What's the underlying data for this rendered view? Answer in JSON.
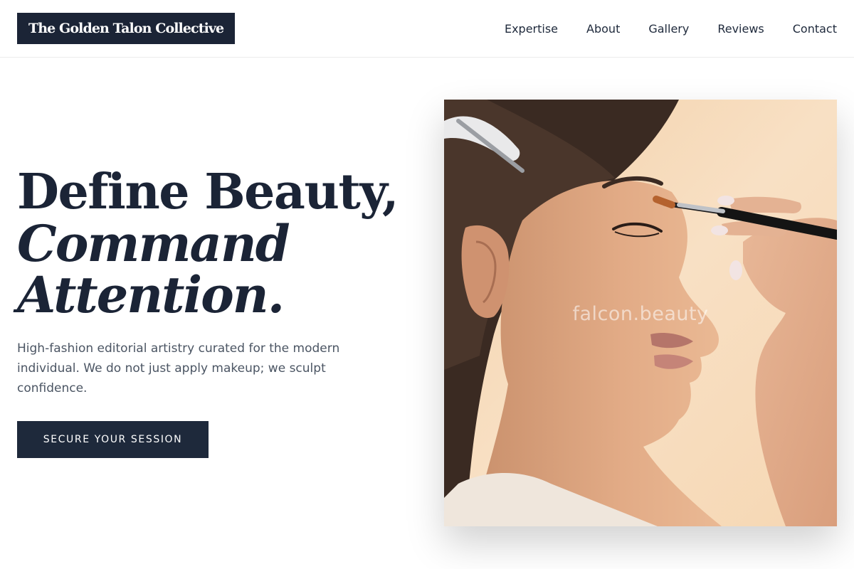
{
  "brand": {
    "name": "The Golden Talon Collective"
  },
  "nav": {
    "items": [
      "Expertise",
      "About",
      "Gallery",
      "Reviews",
      "Contact"
    ]
  },
  "hero": {
    "headline_line1": "Define Beauty,",
    "headline_line2": "Command",
    "headline_line3": "Attention.",
    "subtitle": "High-fashion editorial artistry curated for the modern individual. We do not just apply makeup; we sculpt confidence.",
    "cta_label": "SECURE YOUR SESSION",
    "image_watermark": "falcon.beauty"
  },
  "colors": {
    "brand_navy": "#1b2436",
    "text_primary": "#1e293b",
    "text_secondary": "#4b5563"
  }
}
